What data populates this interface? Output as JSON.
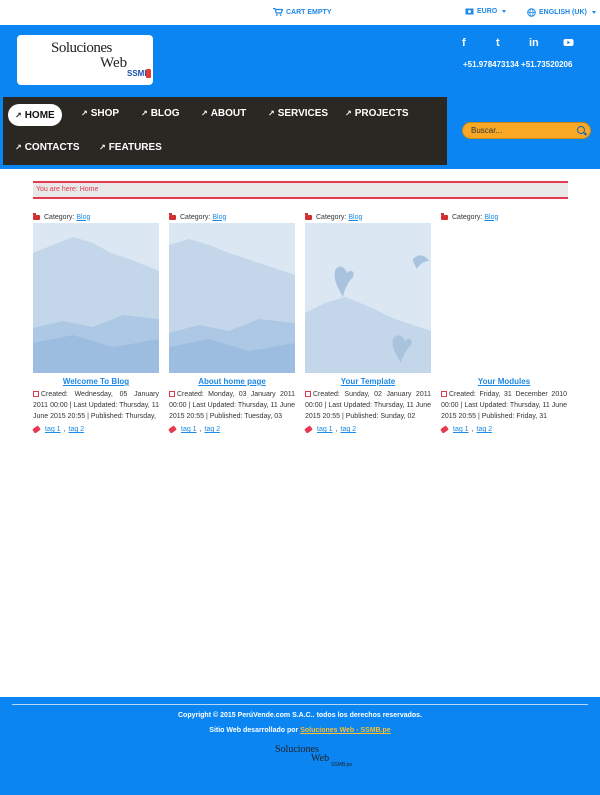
{
  "topbar": {
    "cart_label": "CART EMPTY",
    "currency_label": "EURO",
    "language_label": "ENGLISH (UK)"
  },
  "header": {
    "logo": {
      "line1": "Soluciones",
      "line2": "Web",
      "line3": "SSMB"
    },
    "social": [
      "f",
      "t",
      "in",
      "yt"
    ],
    "phones": "+51.978473134 +51.73520206"
  },
  "nav": {
    "items": [
      {
        "label": "HOME",
        "active": true
      },
      {
        "label": "SHOP"
      },
      {
        "label": "BLOG"
      },
      {
        "label": "ABOUT"
      },
      {
        "label": "SERVICES"
      },
      {
        "label": "PROJECTS"
      },
      {
        "label": "CONTACTS"
      },
      {
        "label": "FEATURES"
      }
    ]
  },
  "search": {
    "placeholder": "Buscar..."
  },
  "breadcrumb": {
    "text": "You are here: Home"
  },
  "articles": [
    {
      "category_label": "Category:",
      "category": "Blog",
      "title": "Welcome To Blog",
      "meta": "Created: Wednesday, 05 January 2011 00:00 | Last Updated: Thursday, 11 June 2015 20:55 | Published: Thursday,",
      "tag1": "tag 1",
      "tag2": "tag 2"
    },
    {
      "category_label": "Category:",
      "category": "Blog",
      "title": "About home page",
      "meta": "Created: Monday, 03 January 2011 00:00 | Last Updated: Thursday, 11 June 2015 20:55 | Published: Tuesday, 03",
      "tag1": "tag 1",
      "tag2": "tag 2"
    },
    {
      "category_label": "Category:",
      "category": "Blog",
      "title": "Your Template",
      "meta": "Created: Sunday, 02 January 2011 00:00 | Last Updated: Thursday, 11 June 2015 20:55 | Published: Sunday, 02",
      "tag1": "tag 1",
      "tag2": "tag 2"
    },
    {
      "category_label": "Category:",
      "category": "Blog",
      "title": "Your Modules",
      "meta": "Created: Friday, 31 December 2010 00:00 | Last Updated: Thursday, 11 June 2015 20:55 | Published: Friday, 31",
      "tag1": "tag 1",
      "tag2": "tag 2"
    }
  ],
  "footer": {
    "copyright": "Copyright © 2015 PerúVende.com S.A.C.. todos los derechos reservados.",
    "siteby_prefix": "Sitio Web desarrollado por",
    "siteby_link": "Soluciones Web - SSMB.pe",
    "logo": {
      "line1": "Soluciones",
      "line2": "Web",
      "line3": "SSMB.pe"
    }
  },
  "colors": {
    "brand_blue": "#0a85f2",
    "nav_dark": "#2b2723",
    "accent_red": "#e53950",
    "search_orange": "#f9a825"
  }
}
